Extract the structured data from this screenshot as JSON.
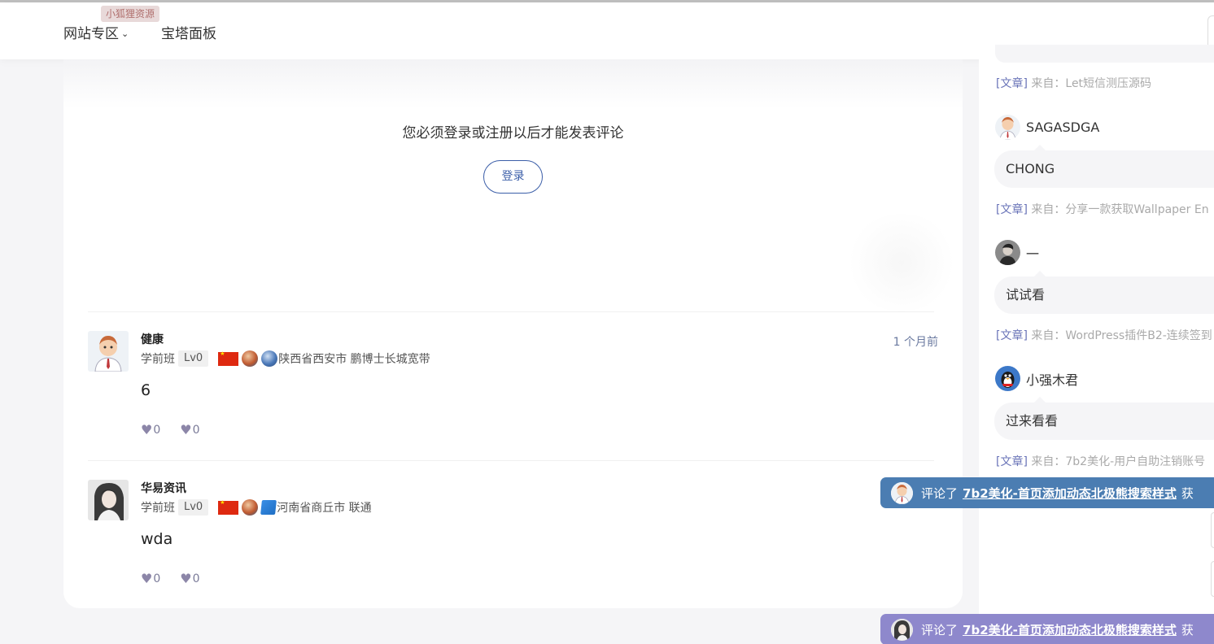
{
  "header": {
    "nav": [
      {
        "label": "网站专区",
        "has_dropdown": true
      },
      {
        "label": "宝塔面板",
        "has_dropdown": false
      }
    ],
    "badge": "小狐狸资源"
  },
  "comment_form": {
    "message": "您必须登录或注册以后才能发表评论",
    "login_label": "登录"
  },
  "comments": [
    {
      "name": "健康",
      "time": "1 个月前",
      "rank": "学前班",
      "level": "Lv0",
      "location": "陕西省西安市 鹏博士长城宽带",
      "text": "6",
      "likes": "0",
      "dislikes": "0"
    },
    {
      "name": "华易资讯",
      "rank": "学前班",
      "level": "Lv0",
      "location": "河南省商丘市 联通",
      "text": "wda",
      "likes": "0",
      "dislikes": "0"
    }
  ],
  "sidebar": {
    "source_tag": "[文章]",
    "source_prefix": "来自：",
    "entries": [
      {
        "source_title": "Let短信测压源码"
      },
      {
        "user": "SAGASDGA",
        "text": "CHONG",
        "source_title": "分享一款获取Wallpaper En"
      },
      {
        "user": "一",
        "text": "试试看",
        "source_title": "WordPress插件B2-连续签到"
      },
      {
        "user": "小强木君",
        "text": "过来看看",
        "source_title": "7b2美化-用户自助注销账号"
      }
    ]
  },
  "toasts": [
    {
      "prefix": "评论了",
      "link": "7b2美化-首页添加动态北极熊搜索样式",
      "suffix": "获",
      "color": "#4b7db2"
    },
    {
      "prefix": "评论了",
      "link": "7b2美化-首页添加动态北极熊搜索样式",
      "suffix": "获",
      "color": "#8e88cc"
    }
  ]
}
